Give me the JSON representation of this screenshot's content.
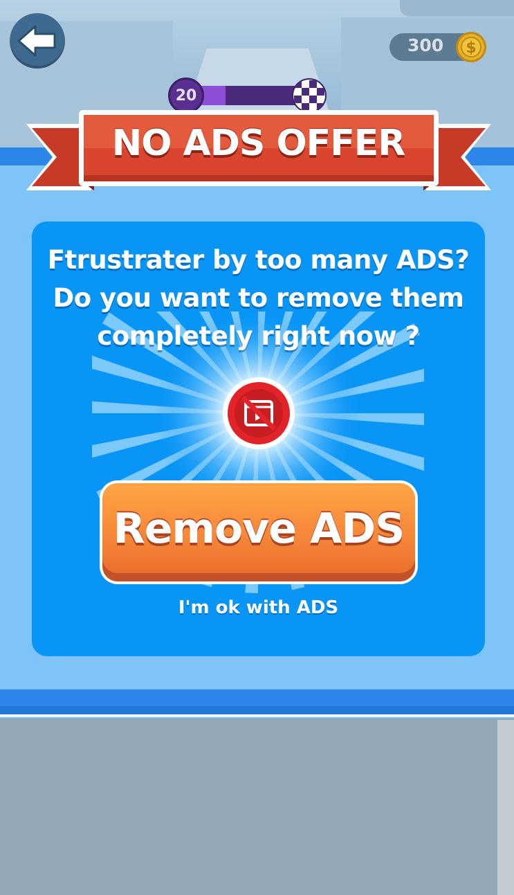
{
  "hud": {
    "coins": "300",
    "level": "20",
    "level_progress": 0.3
  },
  "dialog": {
    "title": "NO ADS OFFER",
    "message_lines": [
      "Ftrustrater by too many ADS?",
      "Do you want to remove them",
      "completely right now ?"
    ],
    "primary_button": "Remove ADS",
    "secondary_link": "I'm ok with ADS"
  },
  "icons": {
    "back": "back-arrow-icon",
    "coin": "dollar-coin-icon",
    "finish": "checkered-flag-icon",
    "no_ads": "no-video-ads-icon"
  },
  "colors": {
    "ribbon_red": "#d9452e",
    "panel_blue": "#7fc4f8",
    "card_blue": "#0995f6",
    "button_orange": "#f7893a",
    "coin_gold": "#e3b12a"
  }
}
